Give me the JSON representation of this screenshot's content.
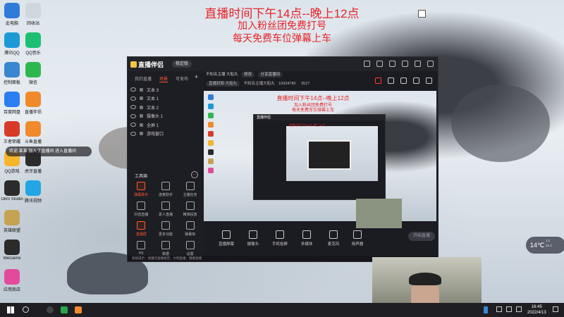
{
  "desktop": {
    "icons_col1": [
      {
        "label": "此电脑",
        "color": "#2f7bd8"
      },
      {
        "label": "腾讯QQ",
        "color": "#1d9ad6"
      },
      {
        "label": "控制面板",
        "color": "#3a86d0"
      },
      {
        "label": "百度网盘",
        "color": "#2a7ef0"
      },
      {
        "label": "王者荣耀",
        "color": "#d83a2a"
      },
      {
        "label": "QQ游戏",
        "color": "#f6b52b"
      },
      {
        "label": "OBS Studio",
        "color": "#2b2b2b"
      },
      {
        "label": "英雄联盟",
        "color": "#c6a253"
      },
      {
        "label": "WeGame",
        "color": "#2b2b2b"
      },
      {
        "label": "应用商店",
        "color": "#e24b9c"
      }
    ],
    "icons_col2": [
      {
        "label": "回收站",
        "color": "#cfd6de"
      },
      {
        "label": "QQ音乐",
        "color": "#1dbf73"
      },
      {
        "label": "微信",
        "color": "#2fb74f"
      },
      {
        "label": "直播伴侣",
        "color": "#f08a2c"
      },
      {
        "label": "斗鱼直播",
        "color": "#f08a2c"
      },
      {
        "label": "虎牙直播",
        "color": "#2b2b2b"
      },
      {
        "label": "腾讯视频",
        "color": "#23a6e3"
      }
    ],
    "promo": {
      "line1": "直播时间下午14点--晚上12点",
      "line2": "加入粉丝团免费打号",
      "line3": "每天免费车位弹幕上车"
    },
    "toast": "欢迎 某某 加入了直播间 进入直播间"
  },
  "app": {
    "logo": "直播伴侣",
    "version_badge": "稳定版",
    "tabs": [
      "我的直播",
      "场景",
      "可发布"
    ],
    "active_tab": "场景",
    "layers": [
      {
        "icon": "text",
        "label": "文本 3"
      },
      {
        "icon": "text",
        "label": "文本 1"
      },
      {
        "icon": "text",
        "label": "文本 2"
      },
      {
        "icon": "camera",
        "label": "摄像头 1"
      },
      {
        "icon": "screen",
        "label": "全屏 1"
      },
      {
        "icon": "window",
        "label": "游戏窗口"
      }
    ],
    "tools_title": "工具箱",
    "tools_more": "···",
    "tools": [
      {
        "label": "弹幕助手",
        "highlight": true
      },
      {
        "label": "连麦助手",
        "highlight": false
      },
      {
        "label": "主播任务",
        "highlight": false
      },
      {
        "label": "抖音直播",
        "highlight": false
      },
      {
        "label": "素人直播",
        "highlight": false
      },
      {
        "label": "精准投放",
        "highlight": false
      },
      {
        "label": "直播屏",
        "highlight": true
      },
      {
        "label": "更多功能",
        "highlight": false
      },
      {
        "label": "弹幕库",
        "highlight": false
      },
      {
        "label": "PK",
        "highlight": false
      },
      {
        "label": "数据",
        "highlight": false
      },
      {
        "label": "设置",
        "highlight": false
      }
    ],
    "title_bar": {
      "stream_title": "不知名主播 大船丸",
      "edit_label": "修改",
      "share_label": "分享直播间"
    },
    "info_bar": {
      "category": "直播封面 大船丸",
      "hint": "不知名主播大船丸",
      "id": "10934780",
      "fans": "3527"
    },
    "canvas_text": {
      "line1": "直播时间下午14点--晚上12点",
      "line2": "加入粉丝团免费打号",
      "line3": "每天免费车位弹幕上车"
    },
    "controls": [
      {
        "label": "直播屏幕"
      },
      {
        "label": "摄像头"
      },
      {
        "label": "手机投屏"
      },
      {
        "label": "多媒体"
      },
      {
        "label": "麦克风"
      },
      {
        "label": "扬声器"
      }
    ],
    "start_button": "开始直播",
    "status_bar": "系统提示：请遵守直播规范，文明直播，健康直播"
  },
  "weather": {
    "temp": "14℃",
    "range_high": "1.2",
    "range_low": "22.4"
  },
  "taskbar": {
    "time": "16:45",
    "date": "2022/4/13"
  }
}
